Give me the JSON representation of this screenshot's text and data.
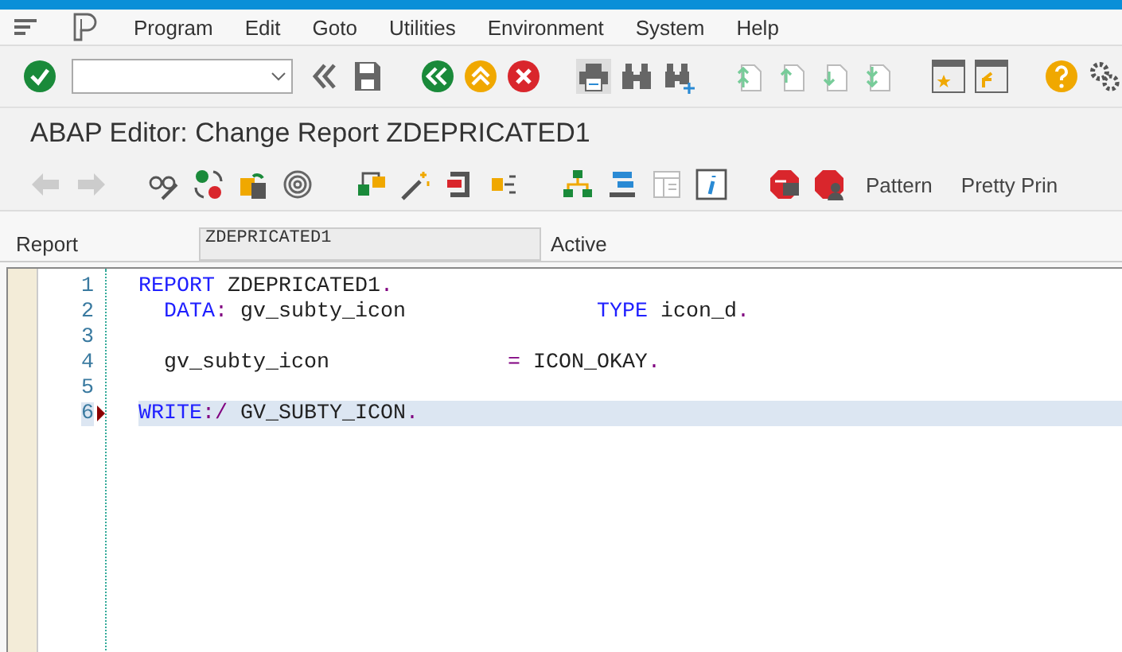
{
  "menu_bar": {
    "items": [
      "Program",
      "Edit",
      "Goto",
      "Utilities",
      "Environment",
      "System",
      "Help"
    ]
  },
  "title": "ABAP Editor: Change Report ZDEPRICATED1",
  "app_toolbar": {
    "buttons": [
      "Pattern",
      "Pretty Prin"
    ]
  },
  "report_row": {
    "label": "Report",
    "value": "ZDEPRICATED1",
    "status": "Active"
  },
  "editor": {
    "lines": [
      {
        "number": "1",
        "breakpoint": false,
        "selected": false,
        "tokens": [
          {
            "kind": "keyword",
            "text": "REPORT"
          },
          {
            "kind": "plain",
            "text": " ZDEPRICATED1"
          },
          {
            "kind": "punct",
            "text": "."
          }
        ]
      },
      {
        "number": "2",
        "breakpoint": false,
        "selected": false,
        "tokens": [
          {
            "kind": "keyword",
            "text": "  DATA"
          },
          {
            "kind": "punct",
            "text": ":"
          },
          {
            "kind": "plain",
            "text": " gv_subty_icon               "
          },
          {
            "kind": "keyword",
            "text": "TYPE"
          },
          {
            "kind": "plain",
            "text": " icon_d"
          },
          {
            "kind": "punct",
            "text": "."
          }
        ]
      },
      {
        "number": "3",
        "breakpoint": false,
        "selected": false
      },
      {
        "number": "4",
        "breakpoint": false,
        "selected": false,
        "tokens": [
          {
            "kind": "plain",
            "text": "  gv_subty_icon              "
          },
          {
            "kind": "punct",
            "text": "="
          },
          {
            "kind": "plain",
            "text": " ICON_OKAY"
          },
          {
            "kind": "punct",
            "text": "."
          }
        ]
      },
      {
        "number": "5",
        "breakpoint": false,
        "selected": false
      },
      {
        "number": "6",
        "breakpoint": true,
        "selected": true,
        "tokens": [
          {
            "kind": "keyword",
            "text": "WRITE"
          },
          {
            "kind": "punct",
            "text": ":/"
          },
          {
            "kind": "plain",
            "text": " GV_SUBTY_ICON"
          },
          {
            "kind": "punct",
            "text": "."
          }
        ]
      }
    ]
  }
}
